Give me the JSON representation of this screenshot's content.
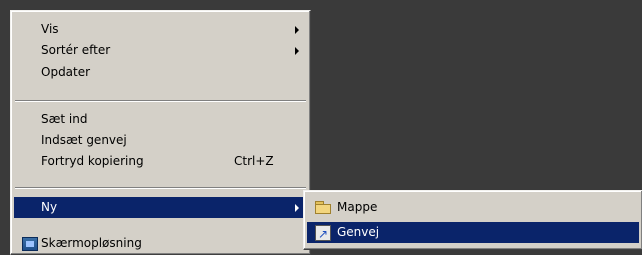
{
  "context_menu": {
    "items": [
      {
        "label": "Vis",
        "has_submenu": true
      },
      {
        "label": "Sortér efter",
        "has_submenu": true
      },
      {
        "label": "Opdater",
        "has_submenu": false
      },
      {
        "label": "Sæt ind",
        "has_submenu": false
      },
      {
        "label": "Indsæt genvej",
        "has_submenu": false
      },
      {
        "label": "Fortryd kopiering",
        "shortcut": "Ctrl+Z",
        "has_submenu": false
      },
      {
        "label": "Ny",
        "has_submenu": true,
        "active": true
      },
      {
        "label": "Skærmopløsning",
        "has_submenu": false
      }
    ]
  },
  "submenu": {
    "items": [
      {
        "label": "Mappe",
        "icon": "folder-icon"
      },
      {
        "label": "Genvej",
        "icon": "shortcut-icon",
        "active": true
      }
    ]
  },
  "colors": {
    "desktop": "#3a3a3a",
    "menu_bg": "#d4d0c8",
    "highlight": "#0a246a",
    "highlight_text": "#ffffff"
  }
}
